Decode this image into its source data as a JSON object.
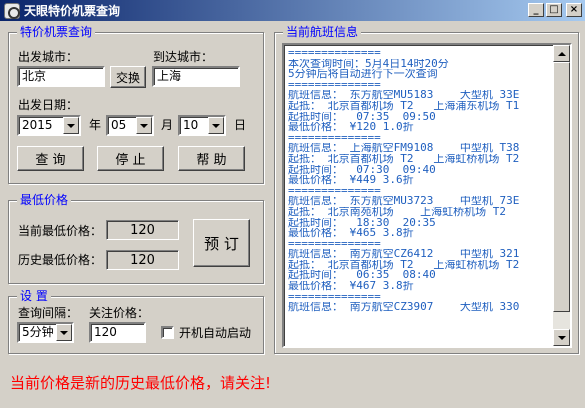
{
  "window": {
    "title": "天眼特价机票查询",
    "min": "_",
    "max": "□",
    "close": "×"
  },
  "query": {
    "legend": "特价机票查询",
    "from_label": "出发城市：",
    "to_label": "到达城市：",
    "from_value": "北京",
    "to_value": "上海",
    "swap_label": "交换",
    "date_label": "出发日期：",
    "year_value": "2015",
    "year_unit": "年",
    "month_value": "05",
    "month_unit": "月",
    "day_value": "10",
    "day_unit": "日",
    "query_button": "查 询",
    "stop_button": "停 止",
    "help_button": "帮 助"
  },
  "lowest": {
    "legend": "最低价格",
    "current_label": "当前最低价格：",
    "current_value": "120",
    "history_label": "历史最低价格：",
    "history_value": "120",
    "book_button": "预 订"
  },
  "settings": {
    "legend": "设 置",
    "interval_label": "查询间隔：",
    "interval_value": "5分钟",
    "watch_label": "关注价格：",
    "watch_value": "120",
    "autostart_label": "开机自动启动"
  },
  "flights": {
    "legend": "当前航班信息",
    "lines": [
      "==============",
      "本次查询时间：5月4日14时20分",
      "5分钟后将自动进行下一次查询",
      "==============",
      "航班信息： 东方航空MU5183    大型机 33E",
      "起抵： 北京首都机场 T2   上海浦东机场 T1",
      "起抵时间：  07:35  09:50",
      "最低价格： ¥120 1.0折",
      "==============",
      "航班信息： 上海航空FM9108    中型机 T38",
      "起抵： 北京首都机场 T2   上海虹桥机场 T2",
      "起抵时间：  07:30  09:40",
      "最低价格： ¥449 3.6折",
      "==============",
      "航班信息： 东方航空MU3723    中型机 73E",
      "起抵： 北京南苑机场    上海虹桥机场 T2",
      "起抵时间：  18:30  20:35",
      "最低价格： ¥465 3.8折",
      "==============",
      "航班信息： 南方航空CZ6412    中型机 321",
      "起抵： 北京首都机场 T2   上海虹桥机场 T2",
      "起抵时间：  06:35  08:40",
      "最低价格： ¥467 3.8折",
      "==============",
      "航班信息： 南方航空CZ3907    大型机 330"
    ]
  },
  "status_message": "当前价格是新的历史最低价格，请关注!"
}
